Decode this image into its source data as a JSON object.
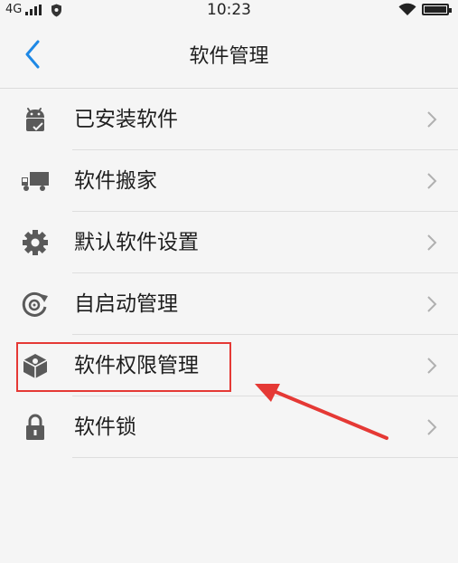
{
  "status_bar": {
    "network": "4G",
    "time": "10:23",
    "battery_level": 1.0
  },
  "header": {
    "title": "软件管理"
  },
  "menu": {
    "items": [
      {
        "label": "已安装软件",
        "icon": "android-check-icon"
      },
      {
        "label": "软件搬家",
        "icon": "truck-icon"
      },
      {
        "label": "默认软件设置",
        "icon": "gear-icon"
      },
      {
        "label": "自启动管理",
        "icon": "startup-icon"
      },
      {
        "label": "软件权限管理",
        "icon": "permission-cube-icon"
      },
      {
        "label": "软件锁",
        "icon": "lock-icon"
      }
    ]
  },
  "colors": {
    "background": "#f5f5f5",
    "accent": "#1e88e5",
    "icon": "#5a5a5a",
    "annotation": "#e53935"
  }
}
